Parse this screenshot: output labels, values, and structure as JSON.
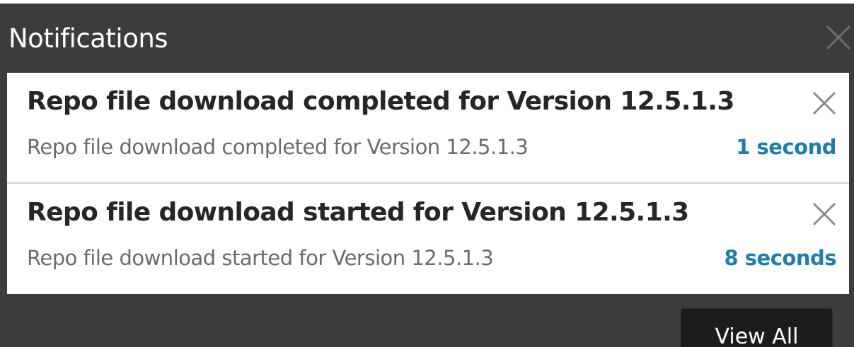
{
  "panel": {
    "title": "Notifications",
    "close_icon": "close-icon"
  },
  "notifications": [
    {
      "title": "Repo file download completed for Version 12.5.1.3",
      "description": "Repo file download completed for Version 12.5.1.3",
      "time": "1 second",
      "dismiss_icon": "close-icon"
    },
    {
      "title": "Repo file download started for Version 12.5.1.3",
      "description": "Repo file download started for Version 12.5.1.3",
      "time": "8 seconds",
      "dismiss_icon": "close-icon"
    }
  ],
  "footer": {
    "view_all_label": "View All"
  },
  "colors": {
    "panel_bg": "#3c3c3c",
    "item_bg": "#ffffff",
    "title_text": "#262626",
    "desc_text": "#6b6b6b",
    "time_accent": "#1e7db0",
    "button_bg": "#1c1c1c"
  }
}
